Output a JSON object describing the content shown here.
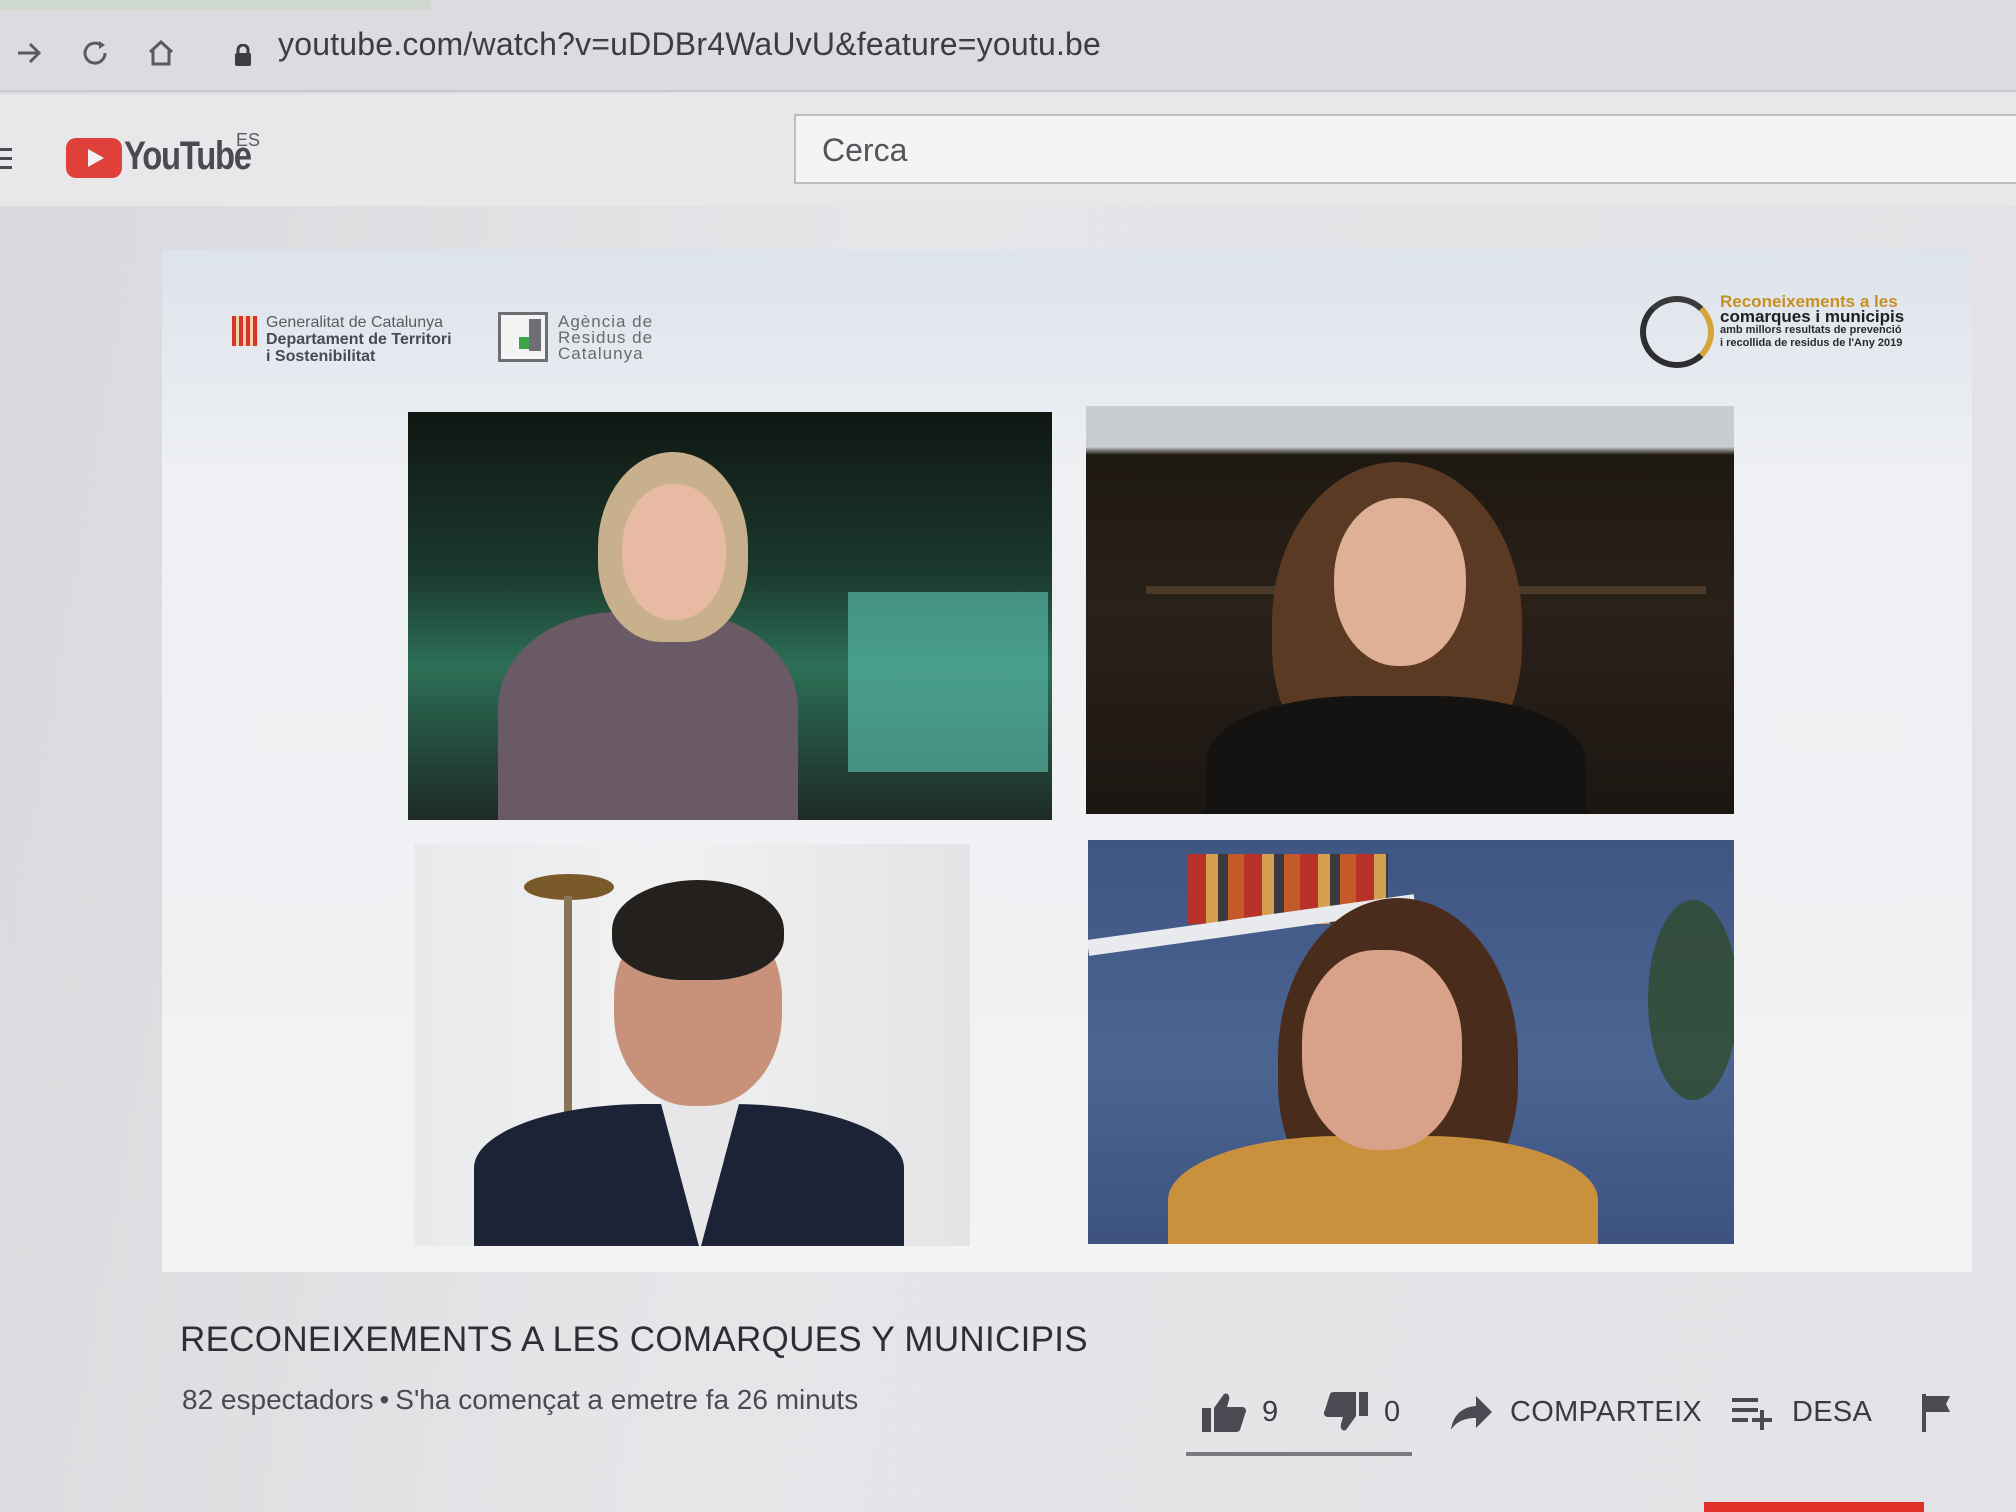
{
  "browser": {
    "url": "youtube.com/watch?v=uDDBr4WaUvU&feature=youtu.be",
    "icons": [
      "forward-icon",
      "reload-icon",
      "home-icon",
      "lock-icon"
    ]
  },
  "masthead": {
    "logo_text": "YouTube",
    "region": "ES",
    "search_placeholder": "Cerca"
  },
  "player": {
    "gencat_line1": "Generalitat de Catalunya",
    "gencat_line2": "Departament de Territori",
    "gencat_line3": "i Sostenibilitat",
    "arc_line1": "Agència de",
    "arc_line2": "Residus de",
    "arc_line3": "Catalunya",
    "recon_line1": "Reconeixements a les",
    "recon_line2": "comarques i municipis",
    "recon_line3": "amb millors resultats de prevenció",
    "recon_line4": "i recollida de residus de l'Any 2019"
  },
  "video": {
    "title": "RECONEIXEMENTS A LES COMARQUES Y MUNICIPIS",
    "viewers": "82 espectadors",
    "separator": "•",
    "started": "S'ha començat a emetre fa 26 minuts"
  },
  "actions": {
    "likes": "9",
    "dislikes": "0",
    "share_label": "COMPARTEIX",
    "save_label": "DESA"
  },
  "colors": {
    "youtube_red": "#e0403a",
    "recon_gold": "#c78f22"
  }
}
